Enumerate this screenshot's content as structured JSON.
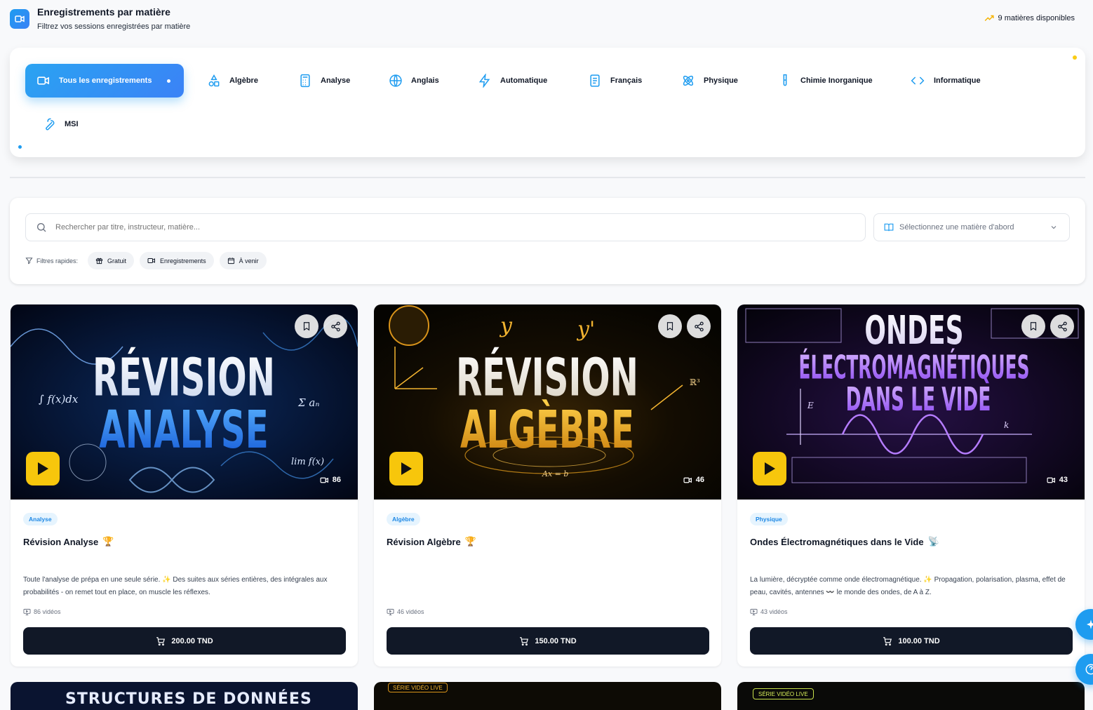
{
  "header": {
    "title": "Enregistrements par matière",
    "subtitle": "Filtrez vos sessions enregistrées par matière",
    "count_label": "9 matières disponibles"
  },
  "subjects": [
    {
      "label": "Tous les enregistrements",
      "icon": "video-icon",
      "active": true
    },
    {
      "label": "Algèbre",
      "icon": "shapes-icon"
    },
    {
      "label": "Analyse",
      "icon": "calculator-icon"
    },
    {
      "label": "Anglais",
      "icon": "globe-icon"
    },
    {
      "label": "Automatique",
      "icon": "zap-icon"
    },
    {
      "label": "Français",
      "icon": "document-icon"
    },
    {
      "label": "Physique",
      "icon": "atom-icon"
    },
    {
      "label": "Chimie Inorganique",
      "icon": "test-tube-icon"
    },
    {
      "label": "Informatique",
      "icon": "code-icon"
    },
    {
      "label": "MSI",
      "icon": "wrench-icon"
    }
  ],
  "search": {
    "placeholder": "Rechercher par titre, instructeur, matière...",
    "select_placeholder": "Sélectionnez une matière d'abord"
  },
  "filters": {
    "label": "Filtres rapides:",
    "chips": [
      "Gratuit",
      "Enregistrements",
      "À venir"
    ]
  },
  "cards": [
    {
      "badge": "Analyse",
      "title": "Révision Analyse",
      "title_emoji": "🏆",
      "description": "Toute l'analyse de prépa en une seule série. ✨ Des suites aux séries entières, des intégrales aux probabilités - on remet tout en place, on muscle les réflexes.",
      "videos_label": "86 vidéos",
      "video_count": "86",
      "price": "200.00 TND",
      "thumb_line1": "RÉVISION",
      "thumb_line2": "ANALYSE"
    },
    {
      "badge": "Algèbre",
      "title": "Révision Algèbre",
      "title_emoji": "🏆",
      "description": "",
      "videos_label": "46 vidéos",
      "video_count": "46",
      "price": "150.00 TND",
      "thumb_line1": "RÉVISION",
      "thumb_line2": "ALGÈBRE"
    },
    {
      "badge": "Physique",
      "title": "Ondes Électromagnétiques dans le Vide",
      "title_emoji": "📡",
      "description": "La lumière, décryptée comme onde électromagnétique. ✨ Propagation, polarisation, plasma, effet de peau, cavités, antennes 〰️ le monde des ondes, de A à Z.",
      "videos_label": "43 vidéos",
      "video_count": "43",
      "price": "100.00 TND",
      "thumb_line1": "ONDES",
      "thumb_line2": "ÉLECTROMAGNÉTIQUES",
      "thumb_line3": "DANS LE VIDE"
    }
  ],
  "bottom_cards": [
    {
      "thumb_text": "STRUCTURES DE DONNÉES"
    },
    {
      "thumb_text": "SÉRIE VIDÉO LIVE"
    },
    {
      "thumb_text": "SÉRIE VIDÉO LIVE"
    }
  ],
  "colors": {
    "accent": "#1e9cf0",
    "play_button": "#f7c60c",
    "buy_button": "#111827",
    "badge_bg": "#e6f4fe"
  }
}
